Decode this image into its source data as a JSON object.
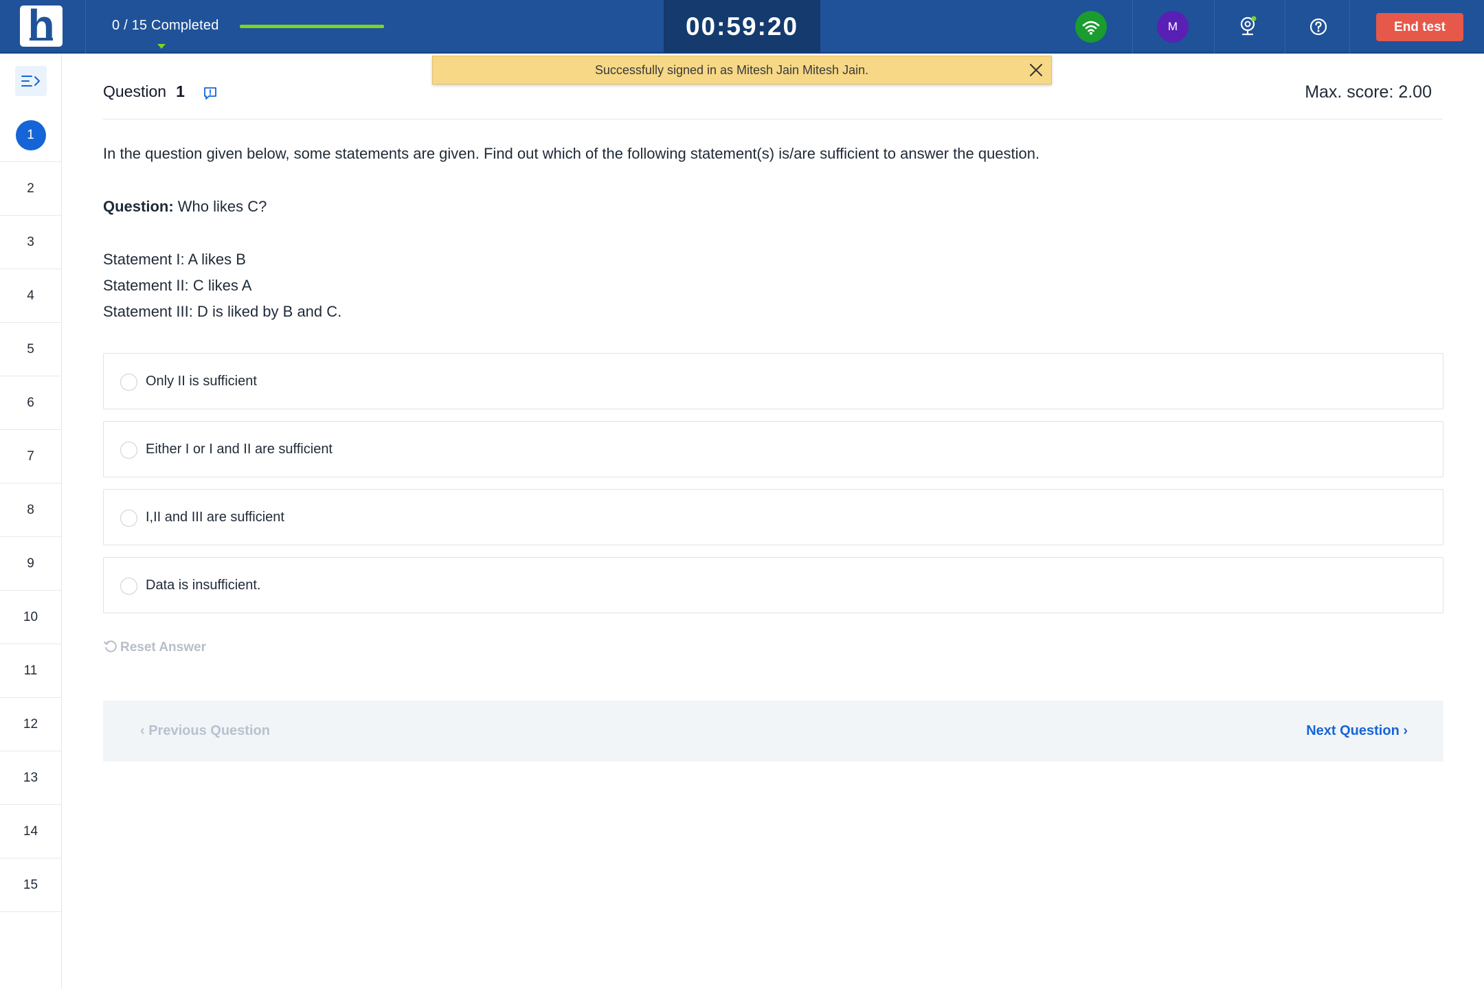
{
  "header": {
    "logo_letter": "h",
    "progress_text": "0 / 15 Completed",
    "progress_fraction": 1,
    "timer": "00:59:20",
    "avatar_initial": "M",
    "end_test_label": "End test"
  },
  "toast": {
    "message": "Successfully signed in as Mitesh Jain Mitesh Jain."
  },
  "sidebar": {
    "questions": [
      "1",
      "2",
      "3",
      "4",
      "5",
      "6",
      "7",
      "8",
      "9",
      "10",
      "11",
      "12",
      "13",
      "14",
      "15"
    ],
    "active_index": 0
  },
  "question": {
    "label": "Question",
    "number": "1",
    "max_score": "Max. score: 2.00",
    "instruction": "In the question given below, some statements are given. Find out which of the following statement(s) is/are sufficient to answer the question.",
    "prompt_label": "Question:",
    "prompt_text": " Who likes C?",
    "statements": [
      "Statement I: A likes B",
      "Statement II: C likes A",
      "Statement III: D is liked by B and C."
    ],
    "options": [
      "Only II is sufficient",
      "Either I or I and II are sufficient",
      "I,II and III are sufficient",
      "Data is insufficient."
    ],
    "reset_label": "Reset Answer"
  },
  "footer": {
    "previous_label": "Previous Question",
    "next_label": "Next Question"
  },
  "colors": {
    "topbar": "#1f5299",
    "timer_bg": "#143a6e",
    "accent": "#1565d8",
    "end_button": "#e5584a",
    "wifi_ok": "#1a9c2e",
    "avatar": "#5a1fb5",
    "toast": "#f6d886"
  }
}
